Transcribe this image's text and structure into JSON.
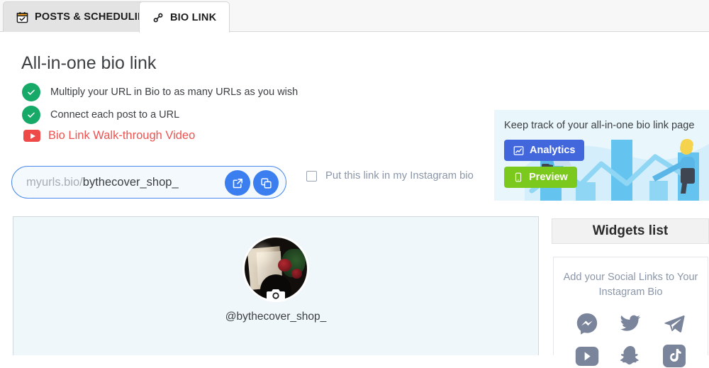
{
  "tabs": [
    {
      "label": "POSTS & SCHEDULING",
      "icon": "calendar-check-icon",
      "active": false
    },
    {
      "label": "BIO LINK",
      "icon": "link-chain-icon",
      "active": true
    }
  ],
  "main": {
    "page_title": "All-in-one bio link",
    "features": [
      "Multiply your URL in Bio to as many URLs as you wish",
      "Connect each post to a URL"
    ],
    "video_link_label": "Bio Link Walk-through Video",
    "video_icon": "youtube-icon"
  },
  "url_field": {
    "prefix": "myurls.bio/",
    "value": "bythecover_shop_",
    "open_button_icon": "external-link-icon",
    "copy_button_icon": "copy-icon"
  },
  "instagram_checkbox": {
    "label": "Put this link in my Instagram bio",
    "checked": false
  },
  "promo": {
    "title": "Keep track of your all-in-one bio link page",
    "analytics_label": "Analytics",
    "analytics_icon": "chart-line-icon",
    "preview_label": "Preview",
    "preview_icon": "mobile-phone-icon"
  },
  "preview_panel": {
    "handle": "@bythecover_shop_",
    "avatar_camera_icon": "camera-icon"
  },
  "widgets": {
    "header": "Widgets list",
    "card_title": "Add your Social Links to Your Instagram Bio",
    "socials": [
      {
        "name": "messenger-icon"
      },
      {
        "name": "twitter-icon"
      },
      {
        "name": "telegram-icon"
      },
      {
        "name": "youtube-icon"
      },
      {
        "name": "snapchat-icon"
      },
      {
        "name": "tiktok-icon"
      }
    ]
  },
  "colors": {
    "tab_active_bg": "#ffffff",
    "tab_inactive_bg": "#e3e3e3",
    "check_green": "#17a967",
    "video_red": "#ed5350",
    "url_border_blue": "#4b89ee",
    "round_button_blue": "#3b7ef0",
    "analytics_blue": "#4267dc",
    "preview_green": "#7cc91e",
    "promo_bg": "#e9f6fb",
    "preview_bg": "#eff7fb",
    "social_gray": "#7a849b"
  }
}
